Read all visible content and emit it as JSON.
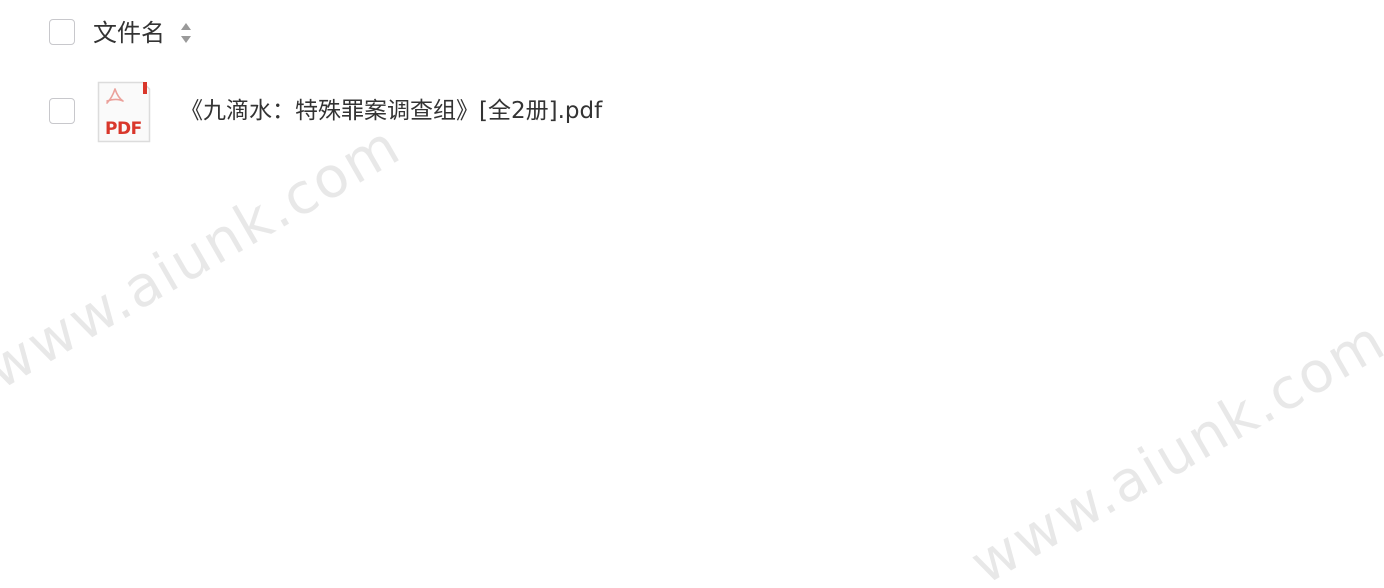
{
  "file_list": {
    "header": {
      "column_label": "文件名"
    },
    "rows": [
      {
        "file_name": "《九滴水：特殊罪案调查组》[全2册].pdf",
        "icon_label": "PDF",
        "icon": "pdf-file-icon"
      }
    ]
  },
  "watermarks": [
    "www.aiunk.com",
    "www.aiunk.com"
  ],
  "colors": {
    "pdf_red": "#d9372b",
    "checkbox_border": "#c8c8cc",
    "text": "#333333"
  }
}
